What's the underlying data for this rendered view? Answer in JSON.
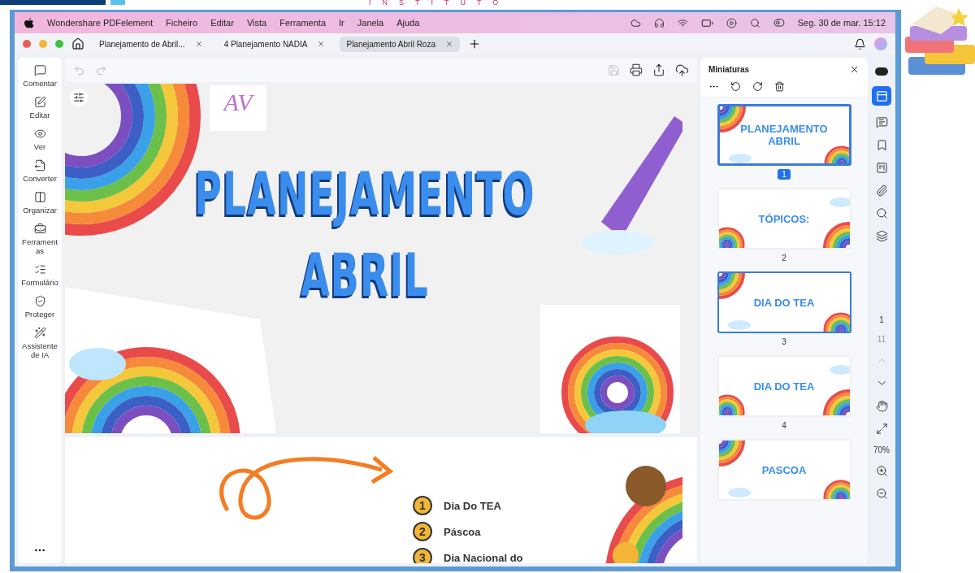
{
  "header_decor": {
    "letters": "INSTITUTO"
  },
  "menu_bar": {
    "app_name": "Wondershare PDFelement",
    "items": [
      "Ficheiro",
      "Editar",
      "Vista",
      "Ferramenta",
      "Ir",
      "Janela",
      "Ajuda"
    ],
    "clock": "Seg. 30 de mar.  15:12"
  },
  "tabs": [
    {
      "label": "Planejamento de Abril...",
      "selected": false
    },
    {
      "label": "4 Planejamento NADIA",
      "selected": false
    },
    {
      "label": "Planejamento Abril Roza",
      "selected": true
    }
  ],
  "sidebar": {
    "items": [
      {
        "label": "Comentar"
      },
      {
        "label": "Editar"
      },
      {
        "label": "Ver"
      },
      {
        "label": "Converter"
      },
      {
        "label": "Organizar"
      },
      {
        "label": "Ferramentas"
      },
      {
        "label": "Formulário"
      },
      {
        "label": "Proteger"
      },
      {
        "label": "Assistente de IA"
      }
    ]
  },
  "document": {
    "page1": {
      "logo": "AV",
      "title_lines": [
        "PLANEJAMENTO",
        "ABRIL"
      ]
    },
    "page2": {
      "topics": [
        {
          "number": "1",
          "label": "Dia Do TEA"
        },
        {
          "number": "2",
          "label": "Páscoa"
        },
        {
          "number": "3",
          "label": "Dia Nacional do"
        }
      ]
    }
  },
  "thumbnails": {
    "title": "Miniaturas",
    "pages": [
      {
        "title": "PLANEJAMENTO ABRIL",
        "number": "1",
        "selected": true,
        "outlined": true
      },
      {
        "title": "TÓPICOS:",
        "number": "2",
        "selected": false,
        "outlined": false
      },
      {
        "title": "DIA DO TEA",
        "number": "3",
        "selected": false,
        "outlined": true
      },
      {
        "title": "DIA DO TEA",
        "number": "4",
        "selected": false,
        "outlined": false
      },
      {
        "title": "PASCOA",
        "selected": false,
        "outlined": false
      }
    ]
  },
  "rail": {
    "current_page": "1",
    "total_pages": "11",
    "zoom": "70%"
  }
}
